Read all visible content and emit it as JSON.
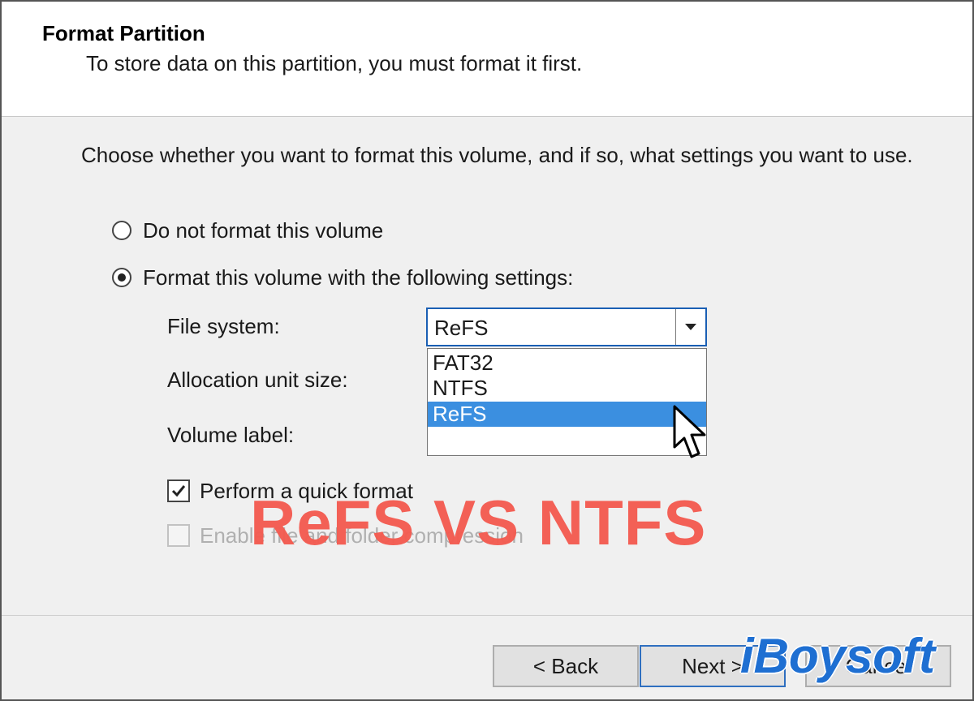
{
  "dialog": {
    "title": "Format Partition",
    "subtitle": "To store data on this partition, you must format it first.",
    "instruction": "Choose whether you want to format this volume, and if so, what settings you want to use."
  },
  "options": {
    "no_format_label": "Do not format this volume",
    "format_label": "Format this volume with the following settings:",
    "selected": "format"
  },
  "fields": {
    "file_system_label": "File system:",
    "file_system_value": "ReFS",
    "allocation_label": "Allocation unit size:",
    "volume_label_label": "Volume label:"
  },
  "dropdown": {
    "items": [
      "FAT32",
      "NTFS",
      "ReFS"
    ],
    "highlighted": "ReFS"
  },
  "checkboxes": {
    "quick_format_label": "Perform a quick format",
    "quick_format_checked": true,
    "compression_label": "Enable file and folder compression",
    "compression_checked": false,
    "compression_enabled": false
  },
  "buttons": {
    "back": "< Back",
    "next": "Next >",
    "cancel": "Cancel"
  },
  "overlay": {
    "title": "ReFS VS NTFS",
    "brand": "iBoysoft"
  },
  "colors": {
    "selection": "#3b8fe0",
    "overlay_text": "#f45b50",
    "brand": "#1e6fd2",
    "focus_border": "#1a5fb4"
  },
  "icons": {
    "combo_arrow": "chevron-down-icon",
    "check": "checkmark-icon",
    "cursor": "mouse-pointer-icon"
  }
}
